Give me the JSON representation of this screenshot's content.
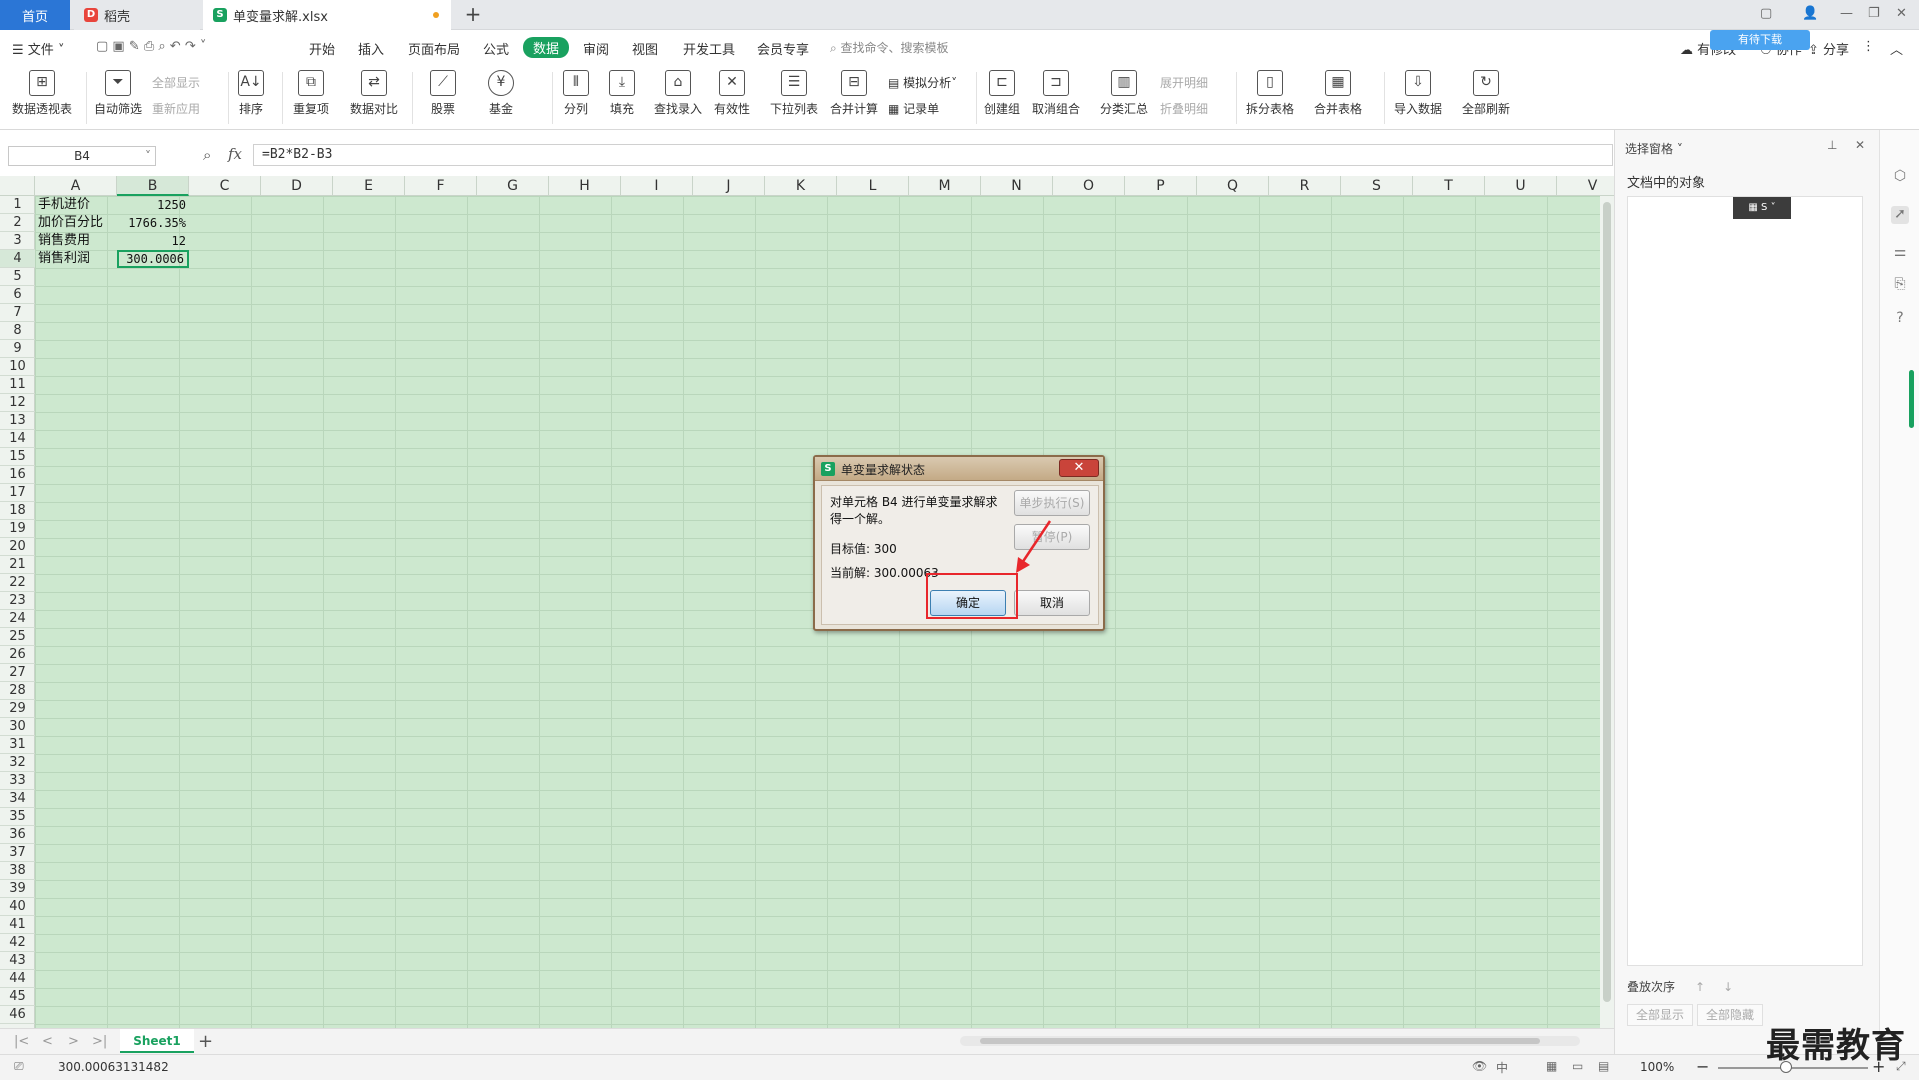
{
  "tabs": {
    "home": "首页",
    "daoke": "稻壳",
    "file": "单变量求解.xlsx"
  },
  "menu": {
    "file": "文件",
    "items": [
      "开始",
      "插入",
      "页面布局",
      "公式",
      "数据",
      "审阅",
      "视图",
      "开发工具",
      "会员专享"
    ],
    "active": "数据",
    "search_placeholder": "查找命令、搜索模板",
    "share": "分享",
    "sync": "有修改",
    "collab": "协作",
    "cloud_badge": "有待下载"
  },
  "ribbon": {
    "pivot": "数据透视表",
    "autofilter": "自动筛选",
    "show_all": "全部显示",
    "reapply": "重新应用",
    "sort": "排序",
    "duplicates": "重复项",
    "compare": "数据对比",
    "stock": "股票",
    "fund": "基金",
    "split": "分列",
    "fill": "填充",
    "lookup": "查找录入",
    "validity": "有效性",
    "dropdown": "下拉列表",
    "consolidate": "合并计算",
    "whatif": "模拟分析",
    "record": "记录单",
    "group": "创建组",
    "ungroup": "取消组合",
    "subtotal": "分类汇总",
    "expand": "展开明细",
    "collapse": "折叠明细",
    "split_table": "拆分表格",
    "merge_table": "合并表格",
    "import": "导入数据",
    "refresh_all": "全部刷新"
  },
  "formula_bar": {
    "name_box": "B4",
    "fx": "fx",
    "formula": "=B2*B2-B3"
  },
  "grid": {
    "columns": [
      "A",
      "B",
      "C",
      "D",
      "E",
      "F",
      "G",
      "H",
      "I",
      "J",
      "K",
      "L",
      "M",
      "N",
      "O",
      "P",
      "Q",
      "R",
      "S",
      "T",
      "U",
      "V"
    ],
    "row_count": 46,
    "cells": [
      {
        "row": 1,
        "label": "手机进价",
        "value": "1250"
      },
      {
        "row": 2,
        "label": "加价百分比",
        "value": "1766.35%"
      },
      {
        "row": 3,
        "label": "销售费用",
        "value": "12"
      },
      {
        "row": 4,
        "label": "销售利润",
        "value": "300.0006"
      }
    ],
    "selected_cell": "B4"
  },
  "sheetbar": {
    "sheet": "Sheet1"
  },
  "status": {
    "value": "300.00063131482",
    "zoom": "100%"
  },
  "right_pane": {
    "title": "选择窗格",
    "objects_label": "文档中的对象",
    "order_label": "叠放次序",
    "show_all": "全部显示",
    "hide_all": "全部隐藏"
  },
  "dialog": {
    "title": "单变量求解状态",
    "message": "对单元格 B4 进行单变量求解求得一个解。",
    "target_label": "目标值: 300",
    "current_label": "当前解: 300.00063",
    "step": "单步执行(S)",
    "pause": "暂停(P)",
    "ok": "确定",
    "cancel": "取消"
  },
  "watermark": "最需教育"
}
